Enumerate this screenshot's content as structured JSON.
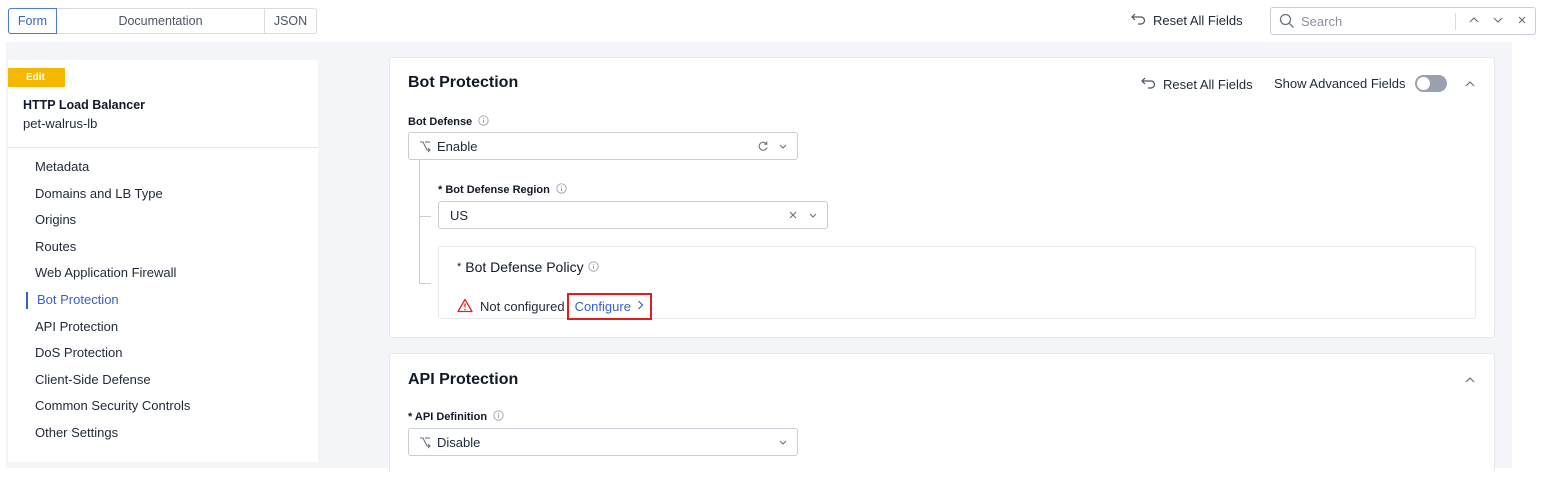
{
  "header": {
    "view_tabs": [
      "Form",
      "Documentation",
      "JSON"
    ],
    "reset_all": "Reset All Fields",
    "search_placeholder": "Search"
  },
  "sidebar": {
    "badge": "Edit",
    "object_type": "HTTP Load Balancer",
    "object_name": "pet-walrus-lb",
    "items": [
      {
        "label": "Metadata"
      },
      {
        "label": "Domains and LB Type"
      },
      {
        "label": "Origins"
      },
      {
        "label": "Routes"
      },
      {
        "label": "Web Application Firewall"
      },
      {
        "label": "Bot Protection",
        "active": true
      },
      {
        "label": "API Protection"
      },
      {
        "label": "DoS Protection"
      },
      {
        "label": "Client-Side Defense"
      },
      {
        "label": "Common Security Controls"
      },
      {
        "label": "Other Settings"
      }
    ]
  },
  "bot_protection": {
    "title": "Bot Protection",
    "reset_all": "Reset All Fields",
    "advanced_label": "Show Advanced Fields",
    "bot_defense_label": "Bot Defense",
    "bot_defense_value": "Enable",
    "region_label": "* Bot Defense Region",
    "region_value": "US",
    "policy_required": "*",
    "policy_label": "Bot Defense Policy",
    "policy_status": "Not configured",
    "configure_label": "Configure"
  },
  "api_protection": {
    "title": "API Protection",
    "definition_label": "* API Definition",
    "definition_value": "Disable"
  },
  "colors": {
    "accent": "#3762c8",
    "edit_badge": "#f5b800",
    "warning": "#e02424",
    "highlight": "#e11d1d"
  }
}
